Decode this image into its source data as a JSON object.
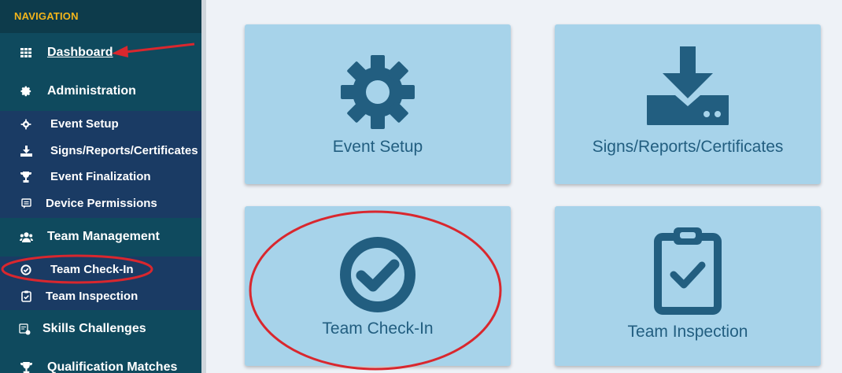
{
  "sidebar": {
    "header": "NAVIGATION",
    "items": [
      {
        "label": "Dashboard",
        "icon": "grid-icon"
      },
      {
        "label": "Administration",
        "icon": "gear-icon"
      },
      {
        "label": "Event Setup",
        "icon": "gear-icon"
      },
      {
        "label": "Signs/Reports/Certificates",
        "icon": "download-icon"
      },
      {
        "label": "Event Finalization",
        "icon": "trophy-icon"
      },
      {
        "label": "Device Permissions",
        "icon": "message-icon"
      },
      {
        "label": "Team Management",
        "icon": "users-icon"
      },
      {
        "label": "Team Check-In",
        "icon": "check-circle-icon"
      },
      {
        "label": "Team Inspection",
        "icon": "clipboard-check-icon"
      },
      {
        "label": "Skills Challenges",
        "icon": "skills-icon"
      },
      {
        "label": "Qualification Matches",
        "icon": "trophy-icon"
      }
    ]
  },
  "tiles": [
    {
      "label": "Event Setup",
      "icon": "gear-icon"
    },
    {
      "label": "Signs/Reports/Certificates",
      "icon": "download-drive-icon"
    },
    {
      "label": "Team Check-In",
      "icon": "check-circle-icon"
    },
    {
      "label": "Team Inspection",
      "icon": "clipboard-check-icon"
    }
  ],
  "colors": {
    "sidebar_bg": "#0f4a5e",
    "sub_bg": "#1a3b64",
    "header_text": "#f3b51b",
    "tile_bg": "#a7d3ea",
    "tile_fg": "#225e80",
    "annotation_red": "#d9272e"
  }
}
